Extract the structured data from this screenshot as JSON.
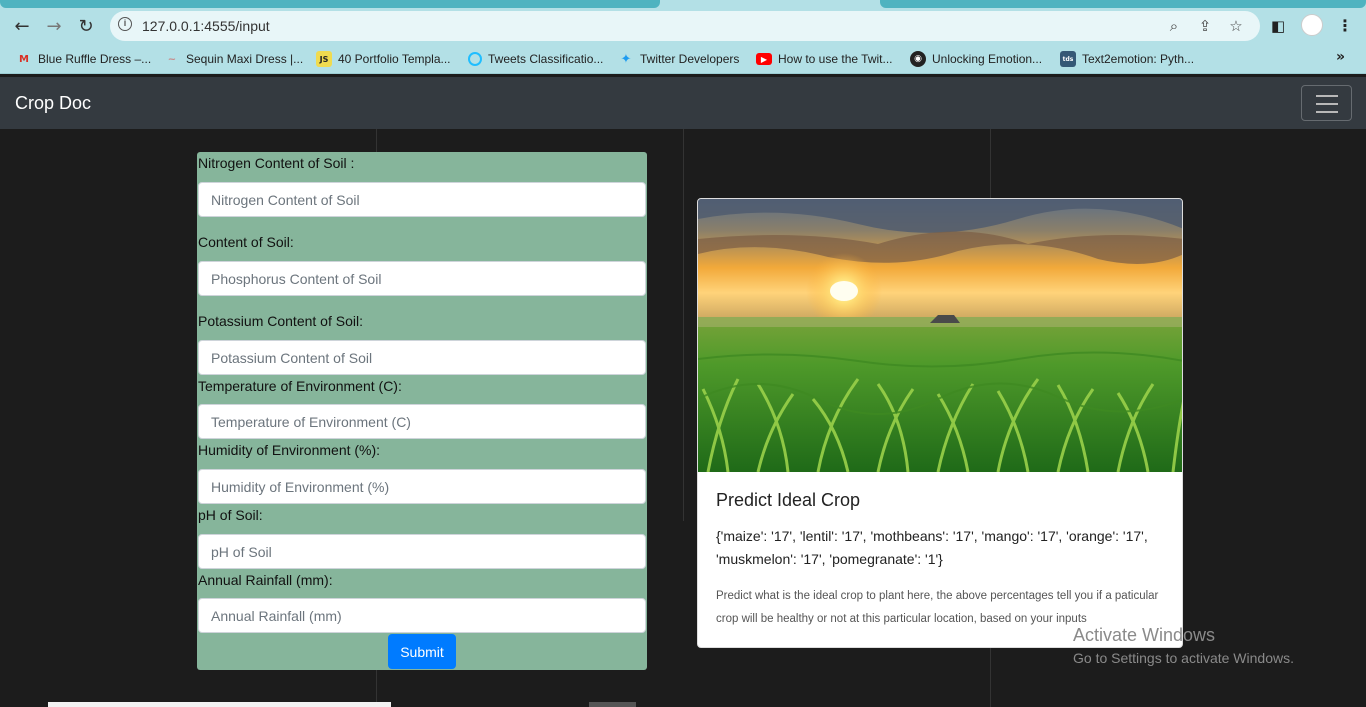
{
  "browser": {
    "url": "127.0.0.1:4555/input",
    "bookmarks": [
      {
        "label": "Blue Ruffle Dress –...",
        "icon": "gmail-icon",
        "color": "#d93025"
      },
      {
        "label": "Sequin Maxi Dress |...",
        "icon": "shop-icon",
        "color": "#c78a8a"
      },
      {
        "label": "40 Portfolio Templa...",
        "icon": "js-icon",
        "color": "#f0db4f"
      },
      {
        "label": "Tweets Classificatio...",
        "icon": "kaggle-icon",
        "color": "#20beff"
      },
      {
        "label": "Twitter Developers",
        "icon": "twitter-icon",
        "color": "#1d9bf0"
      },
      {
        "label": "How to use the Twit...",
        "icon": "youtube-icon",
        "color": "#ff0000"
      },
      {
        "label": "Unlocking Emotion...",
        "icon": "globe-icon",
        "color": "#222222"
      },
      {
        "label": "Text2emotion: Pyth...",
        "icon": "tds-icon",
        "color": "#355876"
      }
    ]
  },
  "navbar": {
    "brand": "Crop Doc"
  },
  "form": {
    "fields": [
      {
        "label": "Nitrogen Content of Soil :",
        "placeholder": "Nitrogen Content of Soil"
      },
      {
        "label": "Content of Soil:",
        "placeholder": "Phosphorus Content of Soil"
      },
      {
        "label": "Potassium Content of Soil:",
        "placeholder": "Potassium Content of Soil"
      },
      {
        "label": "Temperature of Environment (C):",
        "placeholder": "Temperature of Environment (C)"
      },
      {
        "label": "Humidity of Environment (%):",
        "placeholder": "Humidity of Environment (%)"
      },
      {
        "label": "pH of Soil:",
        "placeholder": "pH of Soil"
      },
      {
        "label": "Annual Rainfall (mm):",
        "placeholder": "Annual Rainfall (mm)"
      }
    ],
    "submit_label": "Submit"
  },
  "card": {
    "title": "Predict Ideal Crop",
    "result": "{'maize': '17', 'lentil': '17', 'mothbeans': '17', 'mango': '17', 'orange': '17', 'muskmelon': '17', 'pomegranate': '1'}",
    "description": "Predict what is the ideal crop to plant here, the above percentages tell you if a paticular crop will be healthy or not at this particular location, based on your inputs"
  },
  "watermark": {
    "line1": "Activate Windows",
    "line2": "Go to Settings to activate Windows."
  },
  "colors": {
    "form_bg": "#86b59b",
    "submit": "#007bff",
    "navbar": "#343a40",
    "chrome": "#b3e0e6"
  }
}
